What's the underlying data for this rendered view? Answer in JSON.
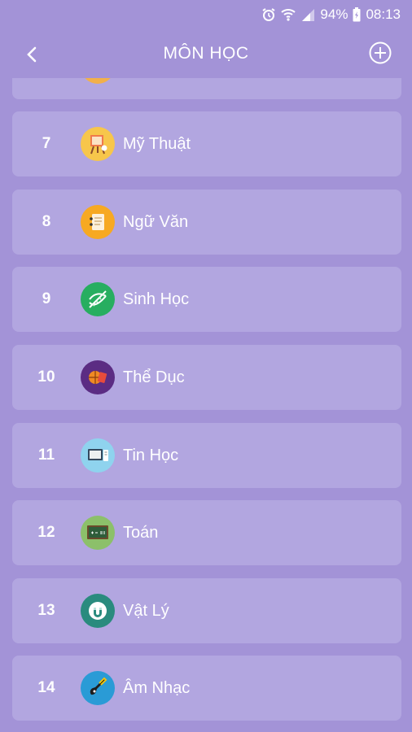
{
  "status": {
    "battery": "94%",
    "time": "08:13"
  },
  "header": {
    "title": "MÔN HỌC"
  },
  "subjects": [
    {
      "number": "",
      "name": "",
      "icon": "partial-icon",
      "color": "#f2b04a"
    },
    {
      "number": "7",
      "name": "Mỹ Thuật",
      "icon": "easel-icon",
      "color": "#f7c64b"
    },
    {
      "number": "8",
      "name": "Ngữ Văn",
      "icon": "notebook-icon",
      "color": "#f7a922"
    },
    {
      "number": "9",
      "name": "Sinh Học",
      "icon": "dna-icon",
      "color": "#27ae60"
    },
    {
      "number": "10",
      "name": "Thể Dục",
      "icon": "sports-icon",
      "color": "#5b2c83"
    },
    {
      "number": "11",
      "name": "Tin Học",
      "icon": "computer-icon",
      "color": "#8fd3ee"
    },
    {
      "number": "12",
      "name": "Toán",
      "icon": "chalkboard-icon",
      "color": "#8cc06a"
    },
    {
      "number": "13",
      "name": "Vật Lý",
      "icon": "magnet-icon",
      "color": "#2a8b7e"
    },
    {
      "number": "14",
      "name": "Âm Nhạc",
      "icon": "guitar-icon",
      "color": "#2a9bd6"
    }
  ]
}
